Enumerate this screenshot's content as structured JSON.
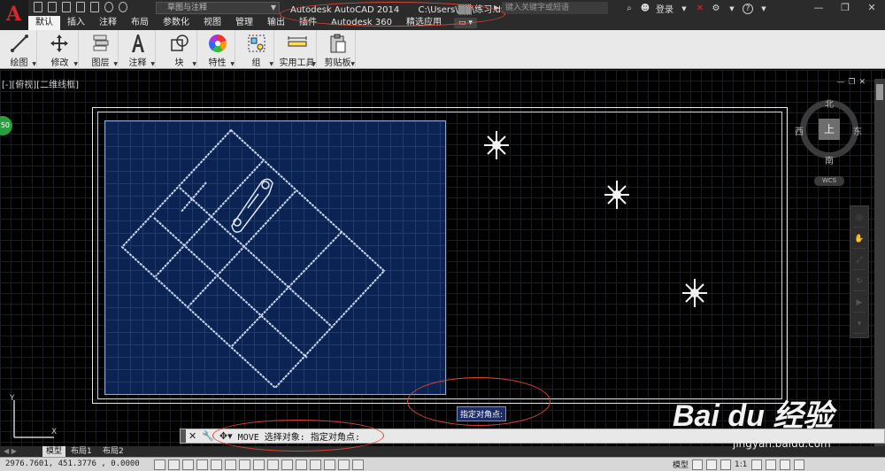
{
  "title_bar": {
    "app_letter": "A",
    "workspace": "草图与注释",
    "app_name": "Autodesk AutoCAD 2014",
    "file_path": "C:\\Users\\▒▒\\练习.dwg",
    "search_placeholder": "键入关键字或短语",
    "login_label": "登录",
    "help_label": "?"
  },
  "ribbon_tabs": [
    "默认",
    "插入",
    "注释",
    "布局",
    "参数化",
    "视图",
    "管理",
    "输出",
    "插件",
    "Autodesk 360",
    "精选应用"
  ],
  "ribbon_panels": [
    {
      "label": "绘图",
      "icon": "line-draw-icon"
    },
    {
      "label": "修改",
      "icon": "move-arrows-icon"
    },
    {
      "label": "图层",
      "icon": "layers-icon"
    },
    {
      "label": "注释",
      "icon": "text-a-icon"
    },
    {
      "label": "块",
      "icon": "block-icon"
    },
    {
      "label": "特性",
      "icon": "color-wheel-icon"
    },
    {
      "label": "组",
      "icon": "group-icon"
    },
    {
      "label": "实用工具",
      "icon": "measure-icon"
    },
    {
      "label": "剪贴板",
      "icon": "clipboard-icon"
    }
  ],
  "viewport": {
    "label": "[-][俯视][二维线框]"
  },
  "compass": {
    "north": "北",
    "south": "南",
    "east": "东",
    "west": "西",
    "top": "上",
    "wcs": "WCS"
  },
  "green_badge": "50",
  "tooltip": "指定对角点:",
  "command_line": {
    "text": "MOVE 选择对象: 指定对角点:"
  },
  "layout_tabs": [
    "模型",
    "布局1",
    "布局2"
  ],
  "status_bar": {
    "coordinates": "2976.7601, 451.3776 , 0.0000",
    "model_label": "模型",
    "scale": "1:1"
  },
  "watermark": {
    "brand": "Bai du 经验",
    "url": "jingyan.baidu.com"
  }
}
